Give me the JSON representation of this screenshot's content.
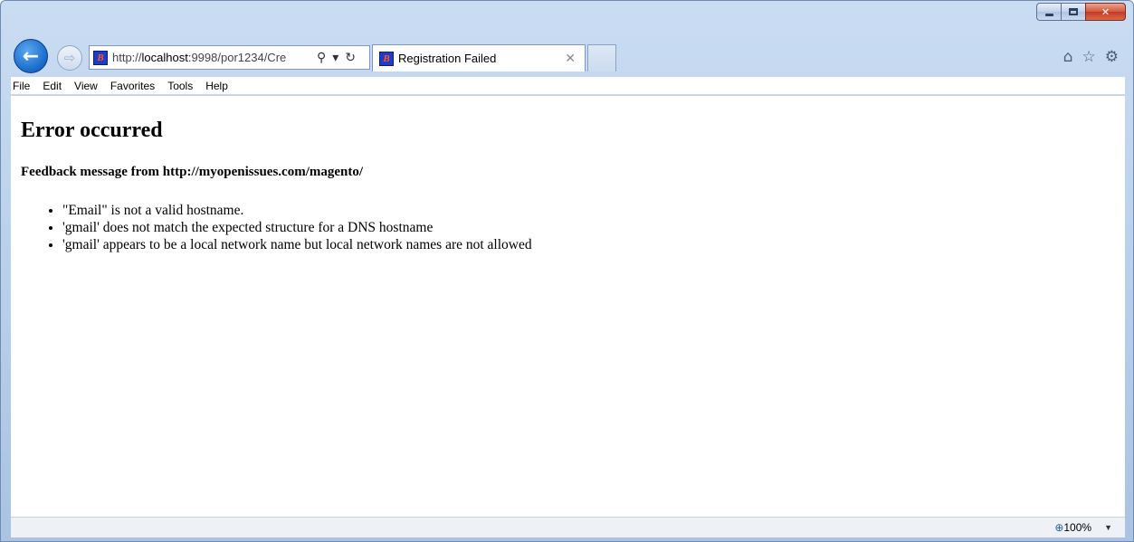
{
  "browser": {
    "address_prefix": "http://",
    "address_host": "localhost",
    "address_rest": ":9998/por1234/Cre",
    "tab_title": "Registration Failed",
    "favicon_letter": "B"
  },
  "menu": [
    "File",
    "Edit",
    "View",
    "Favorites",
    "Tools",
    "Help"
  ],
  "page": {
    "heading": "Error occurred",
    "subheading": "Feedback message from http://myopenissues.com/magento/",
    "errors": [
      "\"Email\" is not a valid hostname.",
      "'gmail' does not match the expected structure for a DNS hostname",
      "'gmail' appears to be a local network name but local network names are not allowed"
    ]
  },
  "status": {
    "zoom_level": "100%"
  },
  "icons": [
    "back-arrow-icon",
    "forward-arrow-icon",
    "search-icon",
    "dropdown-icon",
    "refresh-icon",
    "close-tab-icon",
    "home-icon",
    "favorites-star-icon",
    "settings-gear-icon",
    "zoom-icon",
    "minimize-icon",
    "maximize-icon",
    "close-window-icon"
  ]
}
